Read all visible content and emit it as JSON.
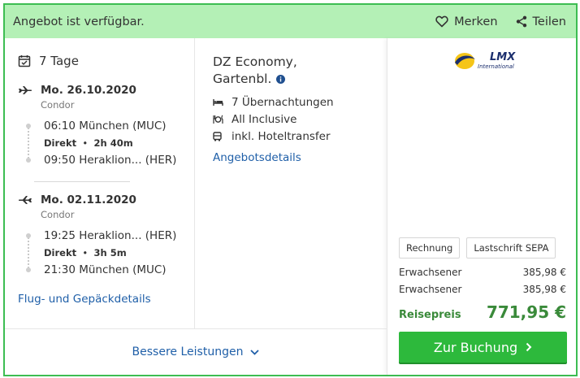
{
  "header": {
    "availability": "Angebot ist verfügbar.",
    "merken_label": "Merken",
    "teilen_label": "Teilen"
  },
  "trip": {
    "duration": "7 Tage",
    "outbound": {
      "date": "Mo. 26.10.2020",
      "carrier": "Condor",
      "depart": "06:10 München (MUC)",
      "direct_label": "Direkt",
      "duration": "2h 40m",
      "arrive": "09:50 Heraklion... (HER)"
    },
    "return": {
      "date": "Mo. 02.11.2020",
      "carrier": "Condor",
      "depart": "19:25 Heraklion... (HER)",
      "direct_label": "Direkt",
      "duration": "3h 5m",
      "arrive": "21:30 München (MUC)"
    },
    "flight_details_link": "Flug- und Gepäckdetails"
  },
  "hotel": {
    "room_line1": "DZ Economy,",
    "room_line2": "Gartenbl.",
    "features": [
      "7 Übernachtungen",
      "All Inclusive",
      "inkl. Hoteltransfer"
    ],
    "details_link": "Angebotsdetails"
  },
  "operator": {
    "logo_text": "LMX",
    "logo_sub": "International"
  },
  "payment": {
    "methods": [
      "Rechnung",
      "Lastschrift SEPA"
    ]
  },
  "pricing": {
    "rows": [
      {
        "label": "Erwachsener",
        "value": "385,98 €"
      },
      {
        "label": "Erwachsener",
        "value": "385,98 €"
      }
    ],
    "total_label": "Reisepreis",
    "total_value": "771,95 €"
  },
  "actions": {
    "book_label": "Zur Buchung",
    "more_label": "Bessere Leistungen"
  },
  "colors": {
    "accent_green": "#2db93c",
    "banner_green": "#b4f0b6",
    "link_blue": "#1f5fa8"
  }
}
